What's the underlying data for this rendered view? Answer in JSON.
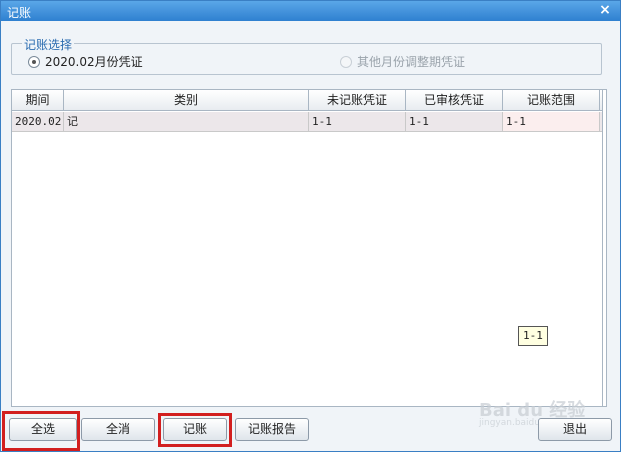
{
  "window": {
    "title": "记账",
    "close_glyph": "×"
  },
  "selection": {
    "legend": "记账选择",
    "option_current": "2020.02月份凭证",
    "option_other": "其他月份调整期凭证"
  },
  "table": {
    "headers": [
      "期间",
      "类别",
      "未记账凭证",
      "已审核凭证",
      "记账范围"
    ],
    "rows": [
      {
        "period": "2020.02",
        "category": "记",
        "unposted": "1-1",
        "audited": "1-1",
        "range": "1-1"
      }
    ]
  },
  "tooltip": "1-1",
  "buttons": {
    "select_all": "全选",
    "clear_all": "全消",
    "post": "记账",
    "report": "记账报告",
    "exit": "退出"
  },
  "watermark": {
    "main": "Bai du 经验",
    "sub": "jingyan.baidu.com"
  },
  "colors": {
    "titlebar": "#2f80d0",
    "highlight": "#d21f1f",
    "accent": "#2b6cb0"
  }
}
